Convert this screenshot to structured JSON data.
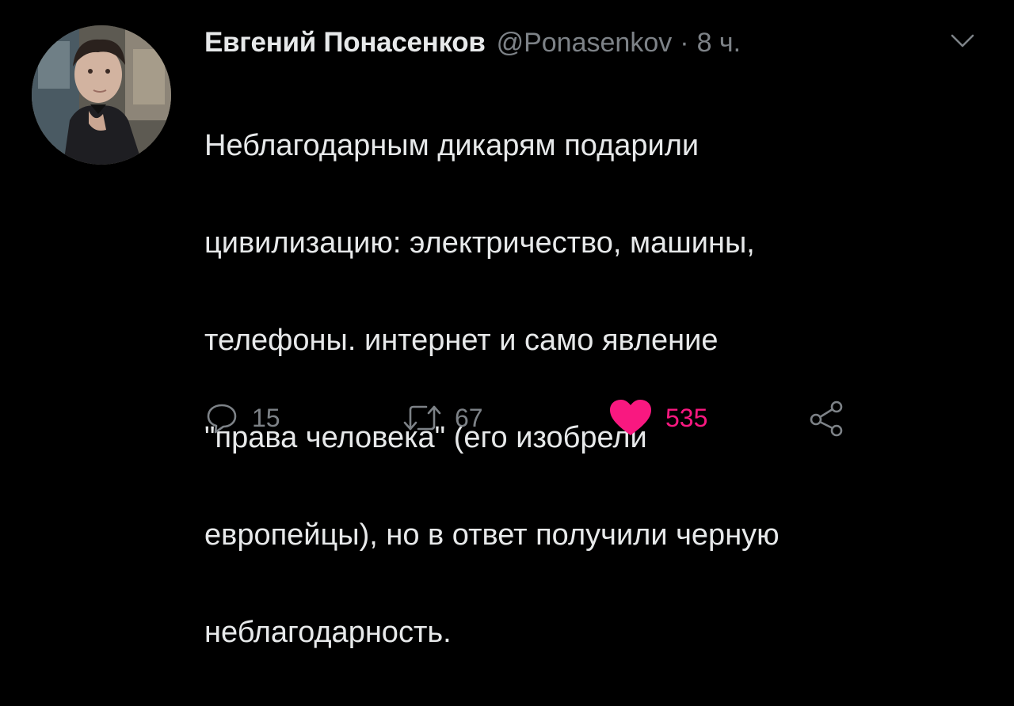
{
  "tweet": {
    "author": {
      "display_name": "Евгений Понасенков",
      "handle": "@Ponasenkov",
      "avatar_icon": "profile-photo"
    },
    "separator": "·",
    "timestamp": "8 ч.",
    "lines": [
      "Неблагодарным дикарям подарили",
      "цивилизацию: электричество, машины,",
      "телефоны. интернет и само явление",
      "\"права человека\" (его изобрели",
      "европейцы), но в ответ получили черную",
      "неблагодарность."
    ],
    "actions": {
      "reply": {
        "icon": "reply-icon",
        "count": "15"
      },
      "retweet": {
        "icon": "retweet-icon",
        "count": "67"
      },
      "like": {
        "icon": "heart-icon",
        "count": "535",
        "liked": true
      },
      "share": {
        "icon": "share-icon"
      }
    }
  },
  "colors": {
    "background": "#000000",
    "text": "#e7e9ea",
    "muted": "#7d8287",
    "like": "#f91880"
  }
}
